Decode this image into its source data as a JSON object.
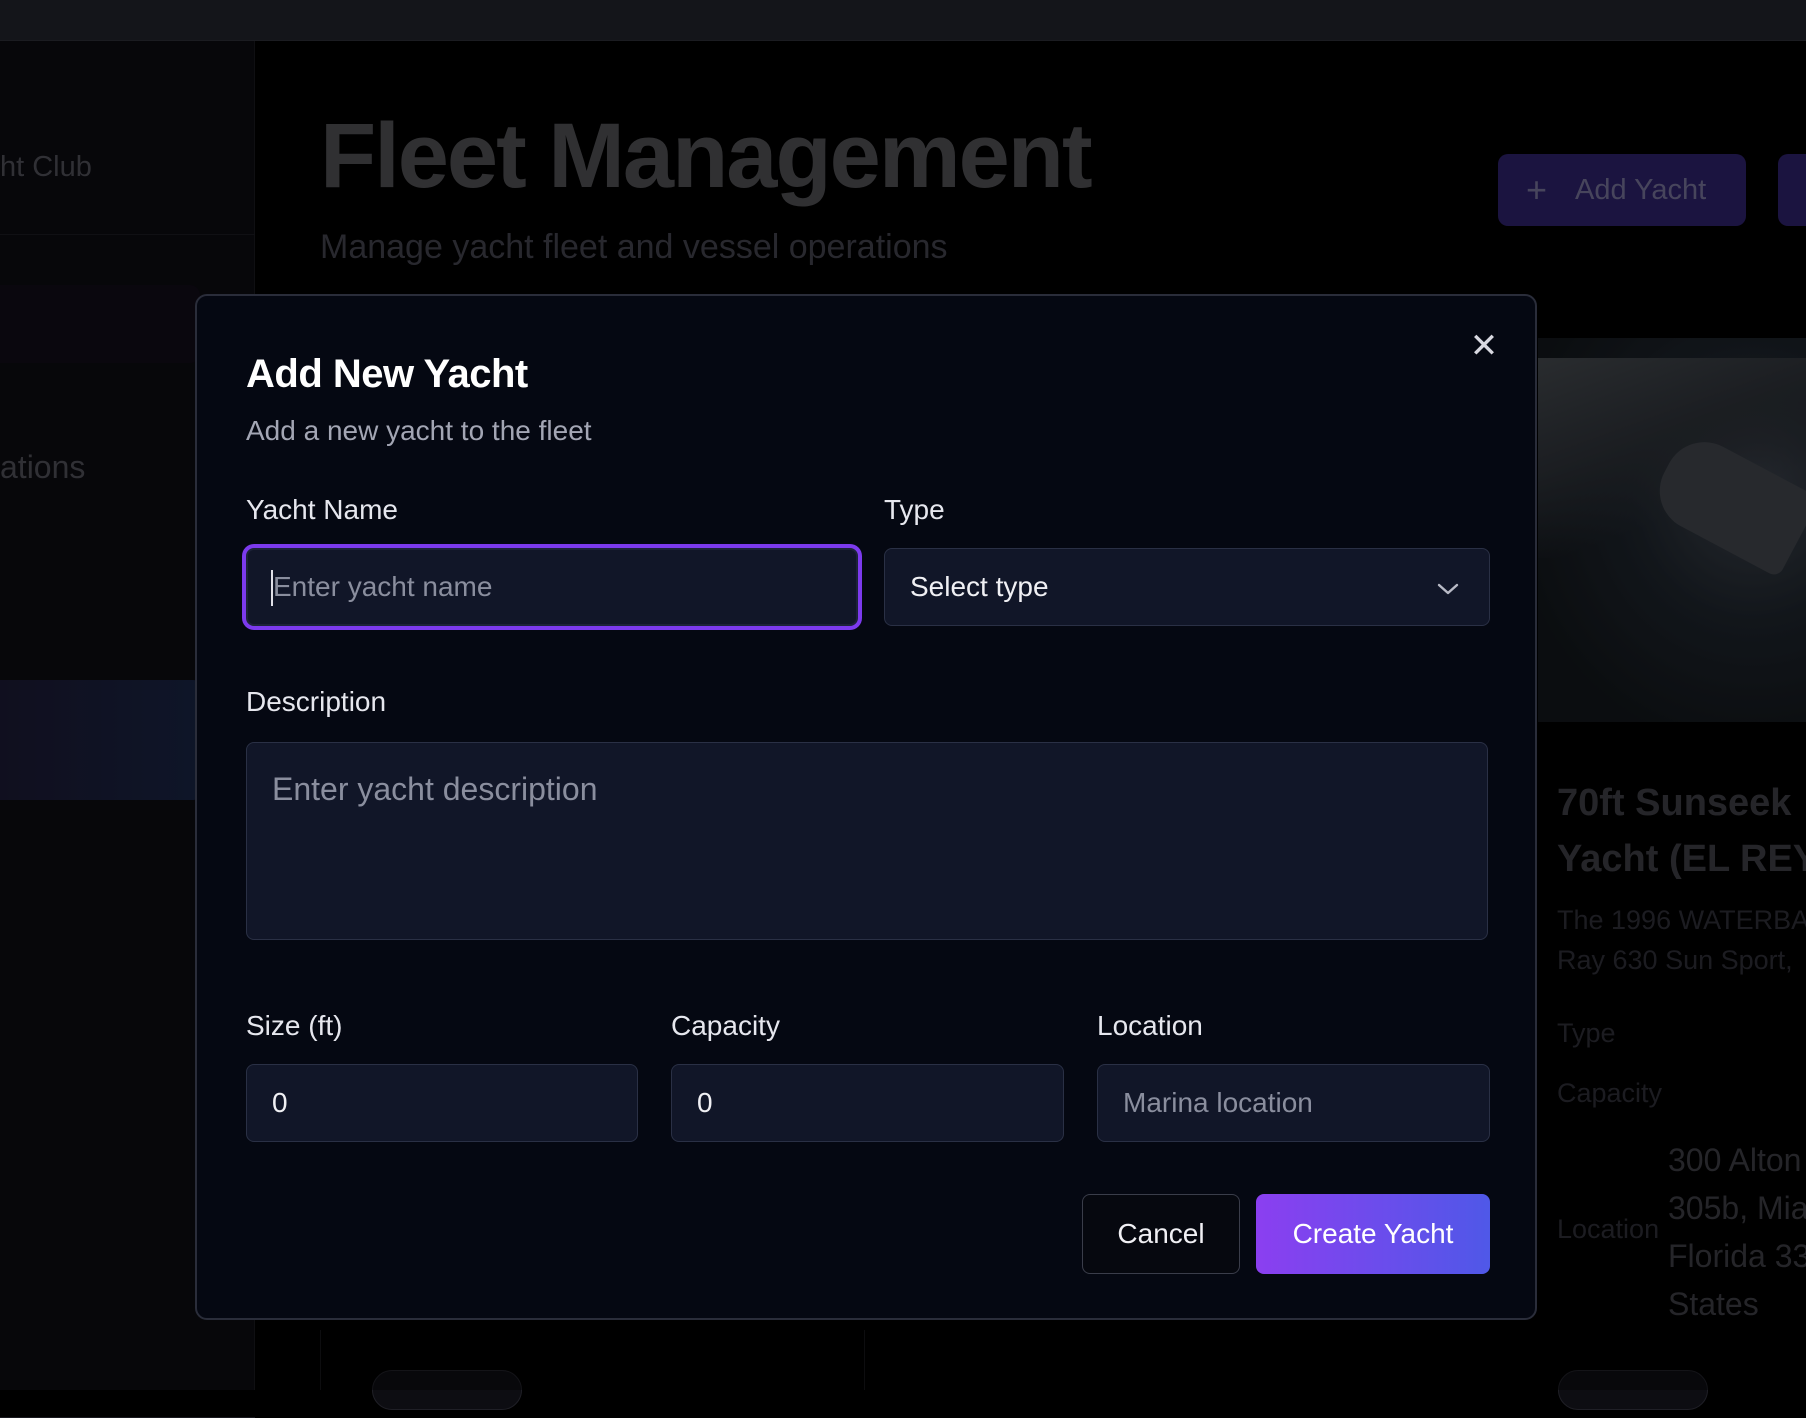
{
  "background": {
    "sidebar": {
      "brand_fragment": "ht Club",
      "section_fragment": "ations"
    },
    "header": {
      "title": "Fleet Management",
      "subtitle": "Manage yacht fleet and vessel operations",
      "add_button_label": "Add Yacht"
    },
    "card": {
      "title_line1": "70ft Sunseek",
      "title_line2": "Yacht (EL REY",
      "desc_line1": "The 1996 WATERBA",
      "desc_line2": "Ray 630 Sun Sport,",
      "type_label": "Type",
      "capacity_label": "Capacity",
      "location_label": "Location",
      "address_lines": [
        "300 Alton",
        "305b, Mia",
        "Florida 33",
        "States"
      ]
    }
  },
  "modal": {
    "title": "Add New Yacht",
    "subtitle": "Add a new yacht to the fleet",
    "fields": {
      "yacht_name": {
        "label": "Yacht Name",
        "placeholder": "Enter yacht name",
        "value": ""
      },
      "type": {
        "label": "Type",
        "selected": "Select type"
      },
      "description": {
        "label": "Description",
        "placeholder": "Enter yacht description"
      },
      "size": {
        "label": "Size (ft)",
        "value": "0"
      },
      "capacity": {
        "label": "Capacity",
        "value": "0"
      },
      "location": {
        "label": "Location",
        "placeholder": "Marina location",
        "value": ""
      }
    },
    "buttons": {
      "cancel": "Cancel",
      "create": "Create Yacht"
    }
  },
  "colors": {
    "accent_focus": "#7c3aed",
    "create_gradient_start": "#8b3ff0",
    "create_gradient_end": "#4f58e8",
    "modal_bg": "#050812",
    "field_bg": "#111628"
  },
  "icons": {
    "close": "close-icon",
    "dropdown": "chevron-down-icon",
    "add": "plus-icon"
  }
}
